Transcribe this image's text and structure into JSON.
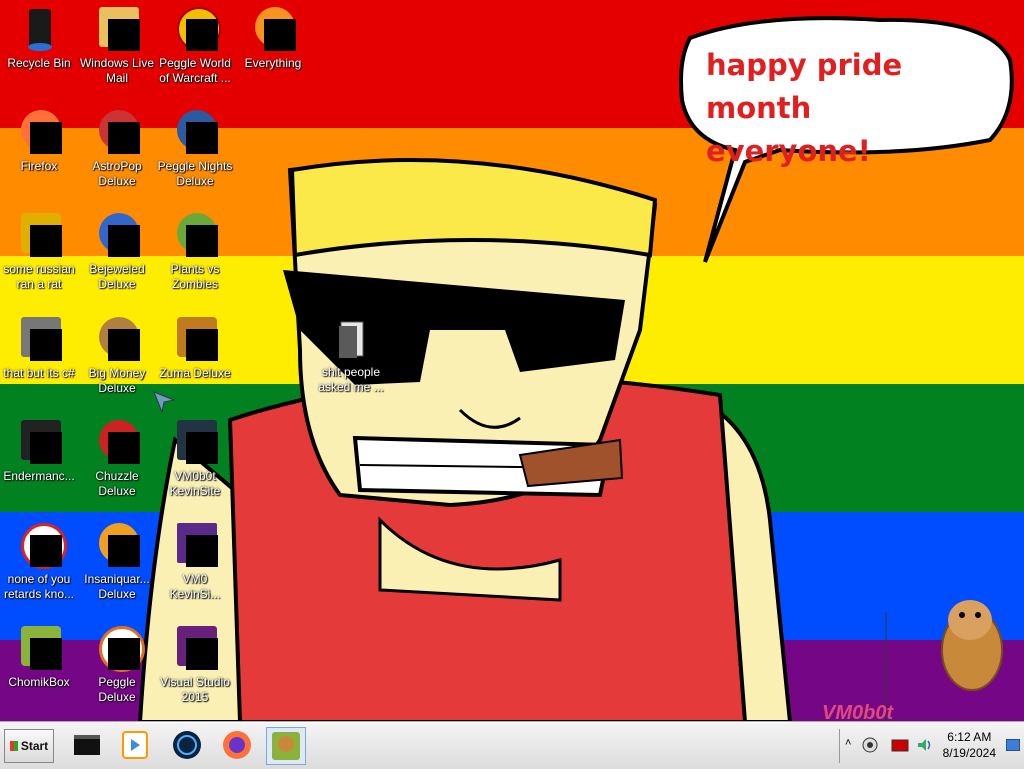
{
  "speech_bubble": {
    "line1": "happy pride month",
    "line2": "everyone!"
  },
  "wallpaper_colors": [
    "#e50000",
    "#ff8c00",
    "#ffed00",
    "#028121",
    "#004dff",
    "#750787"
  ],
  "desktop_icons": [
    {
      "label": "Recycle Bin",
      "icon": "recycle-bin-icon"
    },
    {
      "label": "Windows Live Mail",
      "icon": "windows-live-mail-icon"
    },
    {
      "label": "Peggle World of Warcraft ...",
      "icon": "peggle-wow-icon"
    },
    {
      "label": "Everything",
      "icon": "everything-search-icon"
    },
    {
      "label": "Firefox",
      "icon": "firefox-icon"
    },
    {
      "label": "AstroPop Deluxe",
      "icon": "astropop-icon"
    },
    {
      "label": "Peggle Nights Deluxe",
      "icon": "peggle-nights-icon"
    },
    {
      "label": "some russian ran a rat",
      "icon": "game-icon"
    },
    {
      "label": "Bejeweled Deluxe",
      "icon": "bejeweled-icon"
    },
    {
      "label": "Plants vs Zombies",
      "icon": "plants-vs-zombies-icon"
    },
    {
      "label": "that but its c#",
      "icon": "shortcut-icon"
    },
    {
      "label": "Big Money Deluxe",
      "icon": "big-money-icon"
    },
    {
      "label": "Zuma Deluxe",
      "icon": "zuma-icon"
    },
    {
      "label": "Endermanc...",
      "icon": "terminal-icon"
    },
    {
      "label": "Chuzzle Deluxe",
      "icon": "chuzzle-icon"
    },
    {
      "label": "VM0b0t KevinSite",
      "icon": "vm0b0t-icon"
    },
    {
      "label": "none of you retards kno...",
      "icon": "peggle-icon"
    },
    {
      "label": "Insaniquar... Deluxe",
      "icon": "insaniquarium-icon"
    },
    {
      "label": "VM0 KevinSi...",
      "icon": "document-icon"
    },
    {
      "label": "ChomikBox",
      "icon": "chomikbox-icon"
    },
    {
      "label": "Peggle Deluxe",
      "icon": "peggle-deluxe-icon"
    },
    {
      "label": "Visual Studio 2015",
      "icon": "visual-studio-icon"
    },
    {
      "label": "shit people asked me ...",
      "icon": "folder-icon"
    }
  ],
  "watermark": "VM0b0t",
  "taskbar": {
    "start_label": "Start",
    "pinned": [
      {
        "name": "command-prompt",
        "icon": "cmd-icon"
      },
      {
        "name": "media-player",
        "icon": "media-player-icon"
      },
      {
        "name": "globe-app",
        "icon": "globe-icon"
      },
      {
        "name": "firefox",
        "icon": "firefox-icon"
      },
      {
        "name": "chomikbox",
        "icon": "chomikbox-icon",
        "active": true
      }
    ],
    "clock": {
      "time": "6:12 AM",
      "date": "8/19/2024"
    }
  }
}
